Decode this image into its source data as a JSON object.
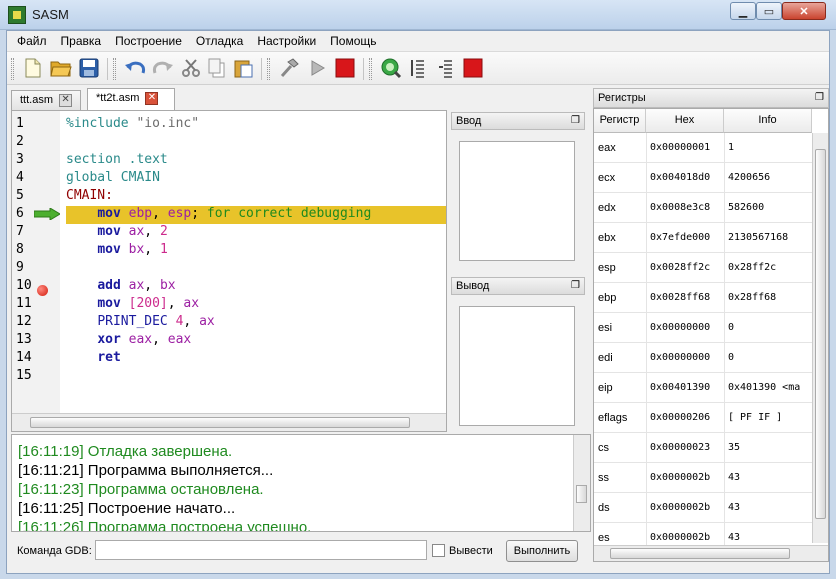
{
  "window": {
    "title": "SASM"
  },
  "menu": [
    "Файл",
    "Правка",
    "Построение",
    "Отладка",
    "Настройки",
    "Помощь"
  ],
  "tabs": [
    {
      "label": "ttt.asm",
      "active": false
    },
    {
      "label": "*tt2t.asm",
      "active": true
    }
  ],
  "editor": {
    "line_numbers": [
      "1",
      "2",
      "3",
      "4",
      "5",
      "6",
      "7",
      "8",
      "9",
      "10",
      "11",
      "12",
      "13",
      "14",
      "15"
    ],
    "current_line": 6,
    "breakpoint_line": 10
  },
  "panes": {
    "input_title": "Ввод",
    "output_title": "Вывод"
  },
  "log": [
    {
      "time": "[16:11:19]",
      "text": " Отладка завершена.",
      "green": true
    },
    {
      "time": "[16:11:21]",
      "text": " Программа выполняется...",
      "green": false
    },
    {
      "time": "[16:11:23]",
      "text": " Программа остановлена.",
      "green": true
    },
    {
      "time": "[16:11:25]",
      "text": " Построение начато...",
      "green": false
    },
    {
      "time": "[16:11:26]",
      "text": " Программа построена успешно.",
      "green": true
    }
  ],
  "gdb": {
    "label": "Команда GDB:",
    "value": "",
    "show_label": "Вывести",
    "run_label": "Выполнить"
  },
  "registers": {
    "title": "Регистры",
    "headers": [
      "Регистр",
      "Hex",
      "Info"
    ],
    "rows": [
      [
        "eax",
        "0x00000001",
        "1"
      ],
      [
        "ecx",
        "0x004018d0",
        "4200656"
      ],
      [
        "edx",
        "0x0008e3c8",
        "582600"
      ],
      [
        "ebx",
        "0x7efde000",
        "2130567168"
      ],
      [
        "esp",
        "0x0028ff2c",
        "0x28ff2c"
      ],
      [
        "ebp",
        "0x0028ff68",
        "0x28ff68"
      ],
      [
        "esi",
        "0x00000000",
        "0"
      ],
      [
        "edi",
        "0x00000000",
        "0"
      ],
      [
        "eip",
        "0x00401390",
        "0x401390 <ma"
      ],
      [
        "eflags",
        "0x00000206",
        "[ PF IF ]"
      ],
      [
        "cs",
        "0x00000023",
        "35"
      ],
      [
        "ss",
        "0x0000002b",
        "43"
      ],
      [
        "ds",
        "0x0000002b",
        "43"
      ],
      [
        "es",
        "0x0000002b",
        "43"
      ]
    ]
  },
  "colors": {
    "current_line": "#e8c32a",
    "log_green": "#1f8a1f",
    "breakpoint": "#d21b0c"
  }
}
